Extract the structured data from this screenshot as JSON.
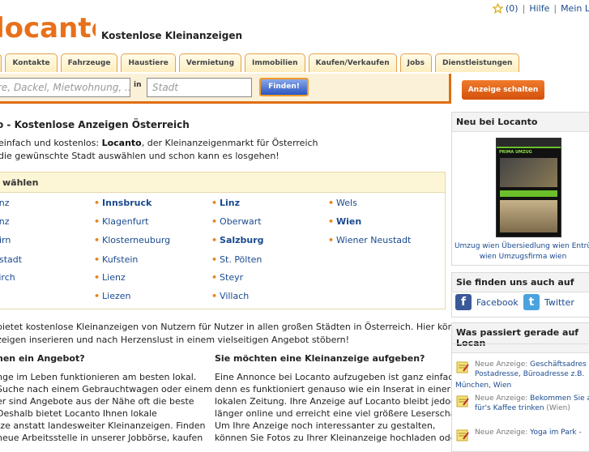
{
  "header": {
    "logo_text": "locanto",
    "tagline": "Kostenlose Kleinanzeigen",
    "favorites_count": "(0)",
    "help": "Hilfe",
    "my_account": "Mein Lo"
  },
  "tabs": [
    "r",
    "Kontakte",
    "Fahrzeuge",
    "Haustiere",
    "Vermietung",
    "Immobilien",
    "Kaufen/Verkaufen",
    "Jobs",
    "Dienstleistungen"
  ],
  "search": {
    "placeholder": "re, Dackel, Mietwohnung, ...",
    "in_label": "in",
    "city_placeholder": "Stadt",
    "find_label": "Finden!",
    "post_ad_label": "Anzeige schalten"
  },
  "main": {
    "title": "o - Kostenlose Anzeigen Österreich",
    "intro_line1_pre": "einfach und kostenlos: ",
    "intro_brand": "Locanto",
    "intro_line1_post": ", der Kleinanzeigenmarkt für Österreich",
    "intro_line2": "die gewünschte Stadt auswählen und schon kann es losgehen!",
    "city_heading": "wählen",
    "cities": [
      [
        "enz",
        "Innsbruck",
        "Linz",
        "Wels"
      ],
      [
        "enz",
        "Klagenfurt",
        "Oberwart",
        "Wien"
      ],
      [
        "birn",
        "Klosterneuburg",
        "Salzburg",
        "Wiener Neustadt"
      ],
      [
        "nstadt",
        "Kufstein",
        "St. Pölten",
        ""
      ],
      [
        "kirch",
        "Lienz",
        "Steyr",
        ""
      ],
      [
        "",
        "Liezen",
        "Villach",
        ""
      ]
    ],
    "para_line1": "bietet kostenlose Kleinanzeigen von Nutzern für Nutzer in allen großen Städten in Österreich. Hier können Sie gratis",
    "para_line2": "zeigen inserieren und nach Herzenslust in einem vielseitigen Angebot stöbern!",
    "left_col": {
      "heading": "hen ein Angebot?",
      "lines": [
        "nge im Leben funktionieren am besten lokal.",
        "Suche nach einem Gebrauchtwagen oder einem",
        "er sind Angebote aus der Nähe oft die beste",
        "Deshalb bietet Locanto Ihnen lokale",
        "tze anstatt landesweiter Kleinanzeigen. Finden",
        "neue Arbeitsstelle in unserer Jobbörse, kaufen"
      ]
    },
    "right_col": {
      "heading": "Sie möchten eine Kleinanzeige aufgeben?",
      "lines": [
        "Eine Annonce bei Locanto aufzugeben ist ganz einfach,",
        "denn es funktioniert genauso wie ein Inserat in einer",
        "lokalen Zeitung. Ihre Anzeige auf Locanto bleibt jedoch",
        "länger online und erreicht eine viel größere Leserschaft.",
        "Um Ihre Anzeige noch interessanter zu gestalten,",
        "können Sie Fotos zu Ihrer Kleinanzeige hochladen oder"
      ]
    }
  },
  "sidebar": {
    "new_heading": "Neu bei Locanto",
    "new_caption_line1": "Umzug wien Übersiedlung wien Entrü",
    "new_caption_line2": "wien Umzugsfirma wien",
    "thumb_label": "PRIMA UMZUG",
    "social_heading": "Sie finden uns auch auf",
    "facebook": "Facebook",
    "twitter": "Twitter",
    "activity_heading": "Was passiert gerade auf Locan",
    "activity": [
      {
        "prefix": "Neue Anzeige: ",
        "link": "Geschäftsadres",
        "line2": "Postadresse, Büroadresse z.B.",
        "line3": "München, Wien"
      },
      {
        "prefix": "Neue Anzeige: ",
        "link": "Bekommen Sie a",
        "line2": "für's Kaffee trinken",
        "line2_suffix": " (Wien)",
        "line3": ""
      },
      {
        "prefix": "Neue Anzeige: ",
        "link": "Yoga im Park -",
        "line2": "",
        "line3": ""
      }
    ]
  }
}
